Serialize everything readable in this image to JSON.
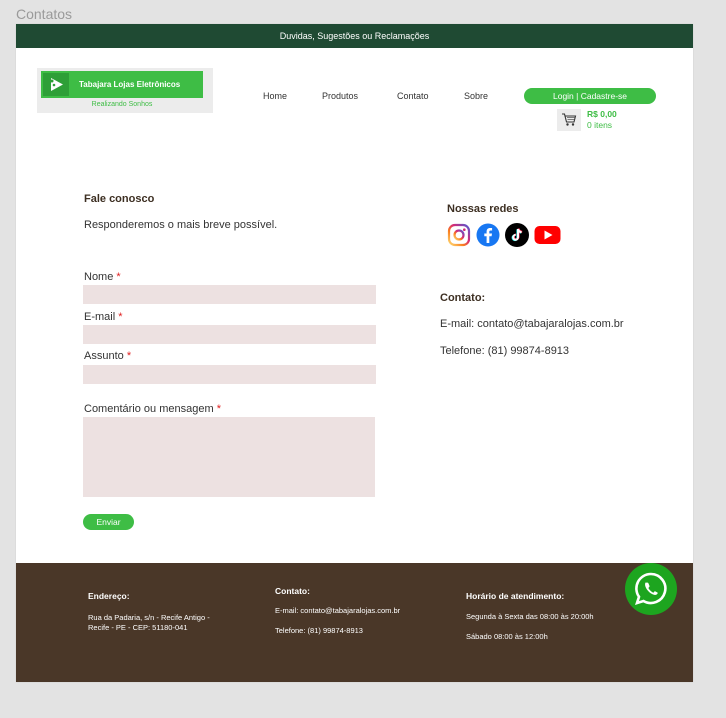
{
  "frame_label": "Contatos",
  "topbar": {
    "text": "Duvidas, Sugestões ou Reclamações"
  },
  "logo": {
    "name": "Tabajara Lojas Eletrônicos",
    "slogan": "Realizando Sonhos"
  },
  "nav": {
    "home": "Home",
    "produtos": "Produtos",
    "contato": "Contato",
    "sobre": "Sobre"
  },
  "login": {
    "label": "Login | Cadastre-se"
  },
  "cart": {
    "price": "R$ 0,00",
    "items": "0 itens",
    "icon": "cart-icon"
  },
  "form": {
    "title": "Fale conosco",
    "subtitle": "Responderemos o mais breve possível.",
    "fields": {
      "nome": {
        "label": "Nome",
        "value": ""
      },
      "email": {
        "label": "E-mail",
        "value": ""
      },
      "assunto": {
        "label": "Assunto",
        "value": ""
      },
      "comentario": {
        "label": "Comentário ou mensagem",
        "value": ""
      }
    },
    "required_mark": "*",
    "submit_label": "Enviar"
  },
  "social": {
    "title": "Nossas redes",
    "icons": [
      "instagram-icon",
      "facebook-icon",
      "tiktok-icon",
      "youtube-icon"
    ]
  },
  "contact": {
    "title": "Contato:",
    "email": "E-mail: contato@tabajaralojas.com.br",
    "phone": "Telefone: (81) 99874-8913"
  },
  "footer": {
    "address_title": "Endereço:",
    "address_line1": "Rua da Padaria, s/n - Recife Antigo -",
    "address_line2": "Recife - PE - CEP: 51180-041",
    "contact_title": "Contato:",
    "contact_email": "E-mail: contato@tabajaralojas.com.br",
    "contact_phone": "Telefone: (81) 99874-8913",
    "hours_title": "Horário de atendimento:",
    "hours_line1": "Segunda à Sexta das 08:00 às 20:00h",
    "hours_line2": "Sábado 08:00 às 12:00h"
  },
  "colors": {
    "brand_green": "#3ebd45",
    "topbar": "#1f4a33",
    "footer": "#4a3728",
    "input_bg": "#ede1e1",
    "whatsapp": "#1da51f"
  }
}
